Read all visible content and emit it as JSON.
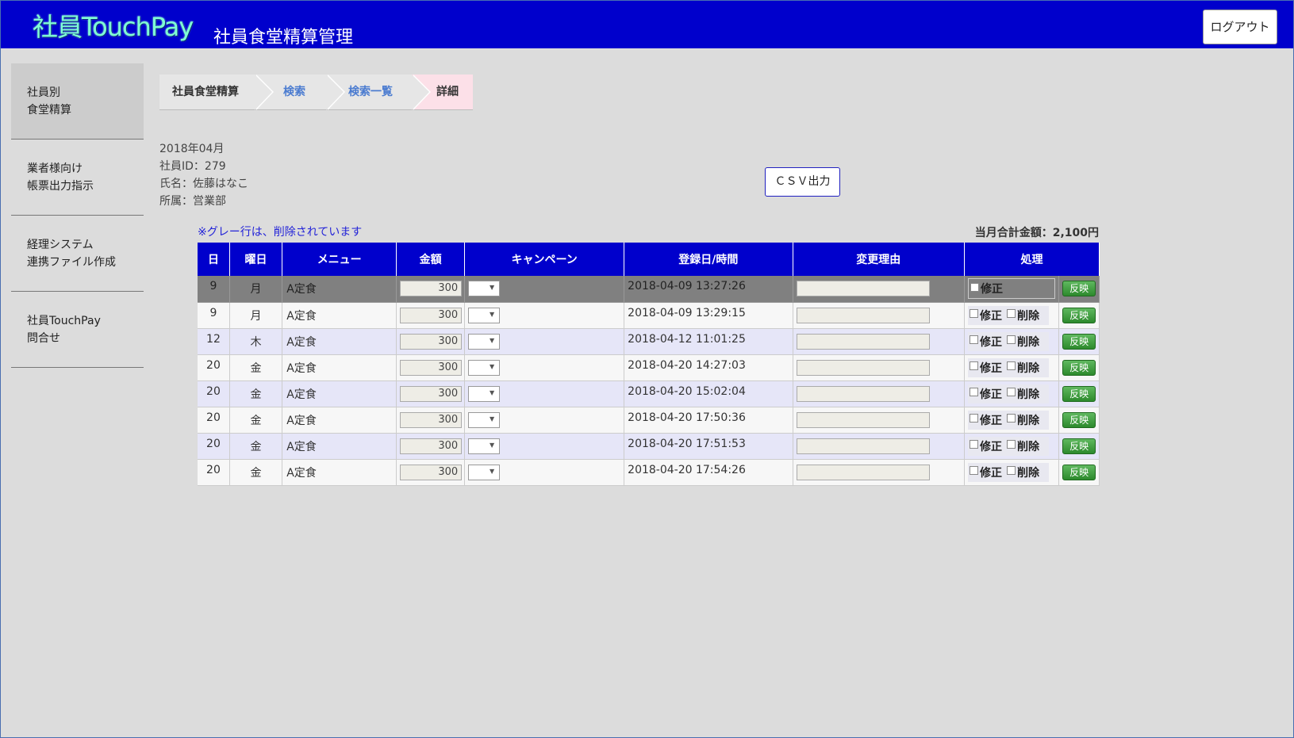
{
  "header": {
    "logo": "社員TouchPay",
    "title": "社員食堂精算管理",
    "logout_label": "ログアウト"
  },
  "sidebar": {
    "items": [
      {
        "line1": "社員別",
        "line2": "食堂精算"
      },
      {
        "line1": "業者様向け",
        "line2": "帳票出力指示"
      },
      {
        "line1": "経理システム",
        "line2": "連携ファイル作成"
      },
      {
        "line1": "社員TouchPay",
        "line2": "問合せ"
      }
    ]
  },
  "breadcrumb": [
    "社員食堂精算",
    "検索",
    "検索一覧",
    "詳細"
  ],
  "info": {
    "month": "2018年04月",
    "employee_id": "社員ID：279",
    "name": "氏名：佐藤はなこ",
    "department": "所属：営業部"
  },
  "csv_label": "ＣＳＶ出力",
  "note": "※グレー行は、削除されています",
  "total": "当月合計金額：2,100円",
  "table": {
    "headers": [
      "日",
      "曜日",
      "メニュー",
      "金額",
      "キャンペーン",
      "登録日/時間",
      "変更理由",
      "処理"
    ],
    "edit_label": "修正",
    "delete_label": "削除",
    "apply_label": "反映",
    "rows": [
      {
        "day": "9",
        "dow": "月",
        "menu": "A定食",
        "amount": "300",
        "datetime": "2018-04-09 13:27:26",
        "deleted": true
      },
      {
        "day": "9",
        "dow": "月",
        "menu": "A定食",
        "amount": "300",
        "datetime": "2018-04-09 13:29:15",
        "deleted": false
      },
      {
        "day": "12",
        "dow": "木",
        "menu": "A定食",
        "amount": "300",
        "datetime": "2018-04-12 11:01:25",
        "deleted": false
      },
      {
        "day": "20",
        "dow": "金",
        "menu": "A定食",
        "amount": "300",
        "datetime": "2018-04-20 14:27:03",
        "deleted": false
      },
      {
        "day": "20",
        "dow": "金",
        "menu": "A定食",
        "amount": "300",
        "datetime": "2018-04-20 15:02:04",
        "deleted": false
      },
      {
        "day": "20",
        "dow": "金",
        "menu": "A定食",
        "amount": "300",
        "datetime": "2018-04-20 17:50:36",
        "deleted": false
      },
      {
        "day": "20",
        "dow": "金",
        "menu": "A定食",
        "amount": "300",
        "datetime": "2018-04-20 17:51:53",
        "deleted": false
      },
      {
        "day": "20",
        "dow": "金",
        "menu": "A定食",
        "amount": "300",
        "datetime": "2018-04-20 17:54:26",
        "deleted": false
      }
    ]
  }
}
